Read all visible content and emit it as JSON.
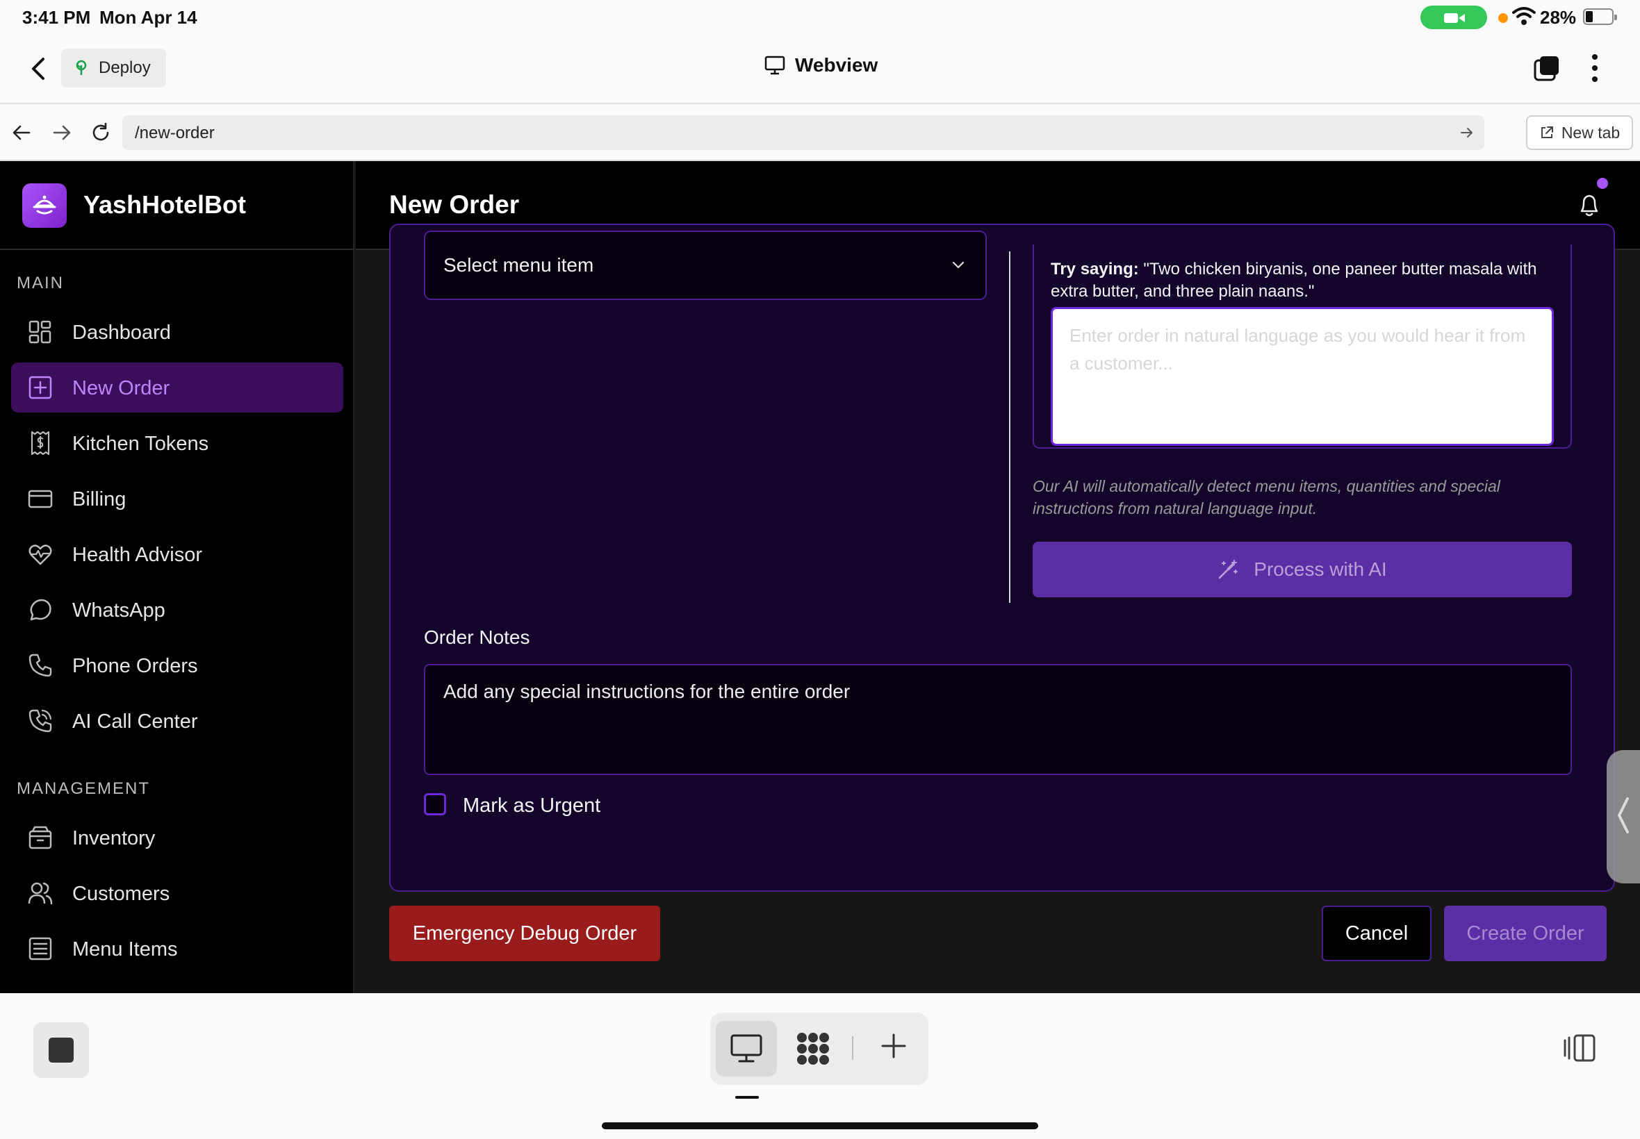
{
  "status_bar": {
    "time": "3:41 PM",
    "date": "Mon Apr 14",
    "battery_percent": "28%",
    "battery_level": 0.28
  },
  "webview": {
    "deploy_label": "Deploy",
    "title": "Webview",
    "url": "/new-order",
    "new_tab_label": "New tab"
  },
  "app": {
    "brand": "YashHotelBot",
    "page_title": "New Order",
    "sidebar": {
      "main_label": "MAIN",
      "main_items": [
        {
          "label": "Dashboard",
          "icon": "dashboard-icon"
        },
        {
          "label": "New Order",
          "icon": "plus-square-icon",
          "active": true
        },
        {
          "label": "Kitchen Tokens",
          "icon": "receipt-icon"
        },
        {
          "label": "Billing",
          "icon": "credit-card-icon"
        },
        {
          "label": "Health Advisor",
          "icon": "heart-pulse-icon"
        },
        {
          "label": "WhatsApp",
          "icon": "chat-bubble-icon"
        },
        {
          "label": "Phone Orders",
          "icon": "phone-icon"
        },
        {
          "label": "AI Call Center",
          "icon": "phone-call-icon"
        }
      ],
      "management_label": "MANAGEMENT",
      "management_items": [
        {
          "label": "Inventory",
          "icon": "box-icon"
        },
        {
          "label": "Customers",
          "icon": "users-icon"
        },
        {
          "label": "Menu Items",
          "icon": "list-icon"
        }
      ]
    },
    "form": {
      "menu_select_value": "Select menu item",
      "try_saying_label": "Try saying:",
      "try_saying_text": " \"Two chicken biryanis, one paneer butter masala with extra butter, and three plain naans.\"",
      "nl_placeholder": "Enter order in natural language as you would hear it from a customer...",
      "ai_hint": "Our AI will automatically detect menu items, quantities and special instructions from natural language input.",
      "process_ai_label": "Process with AI",
      "order_notes_label": "Order Notes",
      "order_notes_placeholder": "Add any special instructions for the entire order",
      "urgent_label": "Mark as Urgent",
      "urgent_checked": false
    },
    "actions": {
      "emergency_label": "Emergency Debug Order",
      "cancel_label": "Cancel",
      "create_label": "Create Order"
    },
    "colors": {
      "accent": "#a855f7",
      "active_nav_bg": "#3b0f5c",
      "card_border": "#4c1d95",
      "emergency": "#991b1b",
      "primary_disabled": "#5b2ea6"
    }
  }
}
